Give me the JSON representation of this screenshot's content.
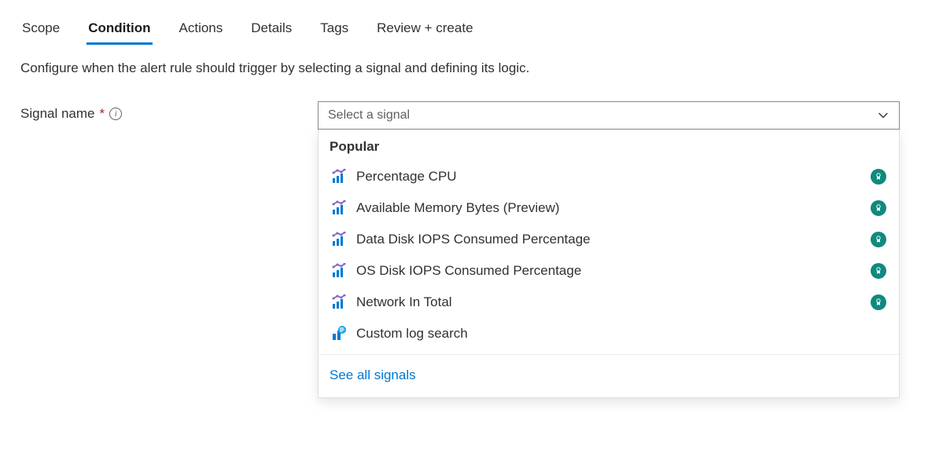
{
  "tabs": {
    "scope": "Scope",
    "condition": "Condition",
    "actions": "Actions",
    "details": "Details",
    "tags": "Tags",
    "review": "Review + create"
  },
  "description": "Configure when the alert rule should trigger by selecting a signal and defining its logic.",
  "field": {
    "label": "Signal name",
    "required_mark": "*",
    "placeholder": "Select a signal"
  },
  "dropdown": {
    "group_header": "Popular",
    "options": [
      {
        "label": "Percentage CPU",
        "icon": "metric",
        "badge": true
      },
      {
        "label": "Available Memory Bytes (Preview)",
        "icon": "metric",
        "badge": true
      },
      {
        "label": "Data Disk IOPS Consumed Percentage",
        "icon": "metric",
        "badge": true
      },
      {
        "label": "OS Disk IOPS Consumed Percentage",
        "icon": "metric",
        "badge": true
      },
      {
        "label": "Network In Total",
        "icon": "metric",
        "badge": true
      },
      {
        "label": "Custom log search",
        "icon": "log",
        "badge": false
      }
    ],
    "see_all": "See all signals"
  }
}
